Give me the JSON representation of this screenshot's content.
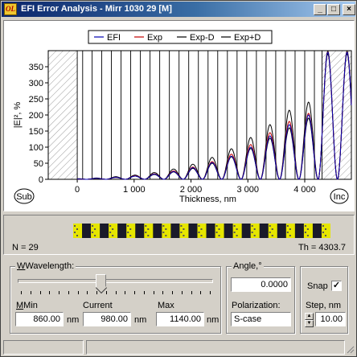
{
  "window": {
    "title": "EFI Error Analysis - Mirr 1030 29 [M]",
    "app_icon_text": "OL",
    "buttons": {
      "minimize": "_",
      "maximize": "□",
      "close": "×"
    }
  },
  "chart_data": {
    "type": "line",
    "xlabel": "Thickness, nm",
    "ylabel": "|E|², %",
    "x_ticks": [
      "0",
      "1 000",
      "2 000",
      "3 000",
      "4 000"
    ],
    "y_ticks": [
      "0",
      "50",
      "100",
      "150",
      "200",
      "250",
      "300",
      "350"
    ],
    "xlim": [
      -510,
      4820
    ],
    "ylim": [
      0,
      400
    ],
    "left_marker": "Sub",
    "right_marker": "Inc",
    "legend": [
      "EFI",
      "Exp",
      "Exp-D",
      "Exp+D"
    ],
    "layer_boundaries": [
      0,
      95,
      260,
      430,
      600,
      770,
      940,
      1110,
      1280,
      1450,
      1620,
      1790,
      1960,
      2130,
      2300,
      2470,
      2640,
      2810,
      2980,
      3150,
      3320,
      3490,
      3660,
      3830,
      4000,
      4170,
      4303.7
    ],
    "series_peaks": {
      "EFI": [
        1,
        3,
        6,
        10,
        16,
        24,
        36,
        52,
        72,
        100,
        135,
        170,
        200,
        395
      ],
      "Exp": [
        1,
        3,
        6,
        11,
        17,
        26,
        38,
        55,
        78,
        108,
        145,
        180,
        205,
        396
      ],
      "Exp-D": [
        1,
        3,
        6,
        10,
        15,
        23,
        34,
        50,
        70,
        96,
        128,
        160,
        190,
        390
      ],
      "Exp+D": [
        2,
        4,
        8,
        13,
        21,
        32,
        47,
        68,
        95,
        130,
        170,
        215,
        240,
        398
      ]
    },
    "colors": {
      "EFI": "#0000b0",
      "Exp": "#c00000",
      "Exp-D": "#000000",
      "Exp+D": "#000000"
    }
  },
  "structure": {
    "n_label": "N = 29",
    "th_label": "Th = 4303.7",
    "layer_count": 29,
    "colors": {
      "high": "#e6e600",
      "low": "#1a1a2a"
    }
  },
  "wavelength": {
    "group_title": "Wavelength:",
    "slider_fraction": 0.42,
    "tick_count": 21,
    "min_label": "Min",
    "min_value": "860.00",
    "current_label": "Current",
    "current_value": "980.00",
    "max_label": "Max",
    "max_value": "1140.00",
    "unit": "nm"
  },
  "angle": {
    "group_title": "Angle,°",
    "value": "0.0000",
    "polarization_label": "Polarization:",
    "polarization_value": "S-case"
  },
  "snap": {
    "label": "Snap",
    "checked": "✓",
    "step_label": "Step, nm",
    "step_value": "10.00",
    "spin_up": "▲",
    "spin_down": "▼"
  }
}
